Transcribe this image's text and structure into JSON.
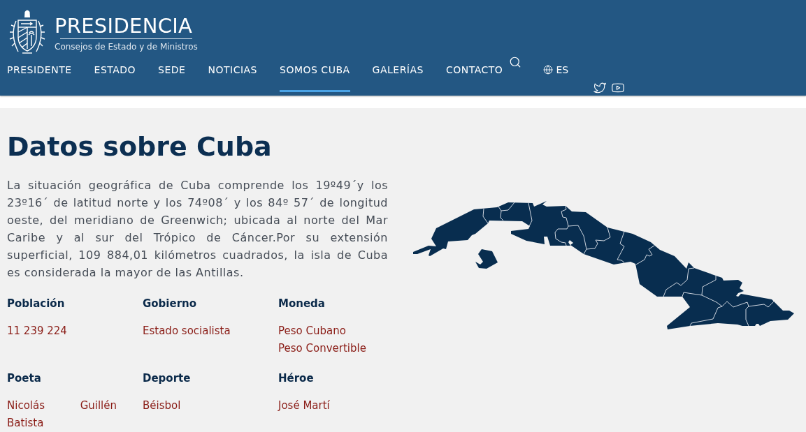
{
  "header": {
    "title": "PRESIDENCIA",
    "subtitle": "Consejos de Estado y de Ministros"
  },
  "nav": {
    "items": [
      {
        "label": "PRESIDENTE",
        "selected": false
      },
      {
        "label": "ESTADO",
        "selected": false
      },
      {
        "label": "SEDE",
        "selected": false
      },
      {
        "label": "NOTICIAS",
        "selected": false
      },
      {
        "label": "SOMOS CUBA",
        "selected": true
      },
      {
        "label": "GALERÍAS",
        "selected": false
      },
      {
        "label": "CONTACTO",
        "selected": false
      }
    ],
    "language": "ES"
  },
  "page": {
    "title": "Datos sobre Cuba",
    "intro": "La situación geográfica de Cuba comprende los 19º49´y los 23º16´ de latitud norte y los 74º08´ y los 84º 57´ de longitud oeste, del meridiano de Greenwich; ubicada al norte del Mar Caribe y al sur del Trópico de Cáncer.Por su extensión superficial, 109 884,01 kilómetros cuadrados, la isla de Cuba es considerada la mayor de las Antillas.",
    "facts": [
      {
        "label": "Población",
        "values": [
          "11 239 224"
        ]
      },
      {
        "label": "Gobierno",
        "values": [
          "Estado socialista"
        ]
      },
      {
        "label": "Moneda",
        "values": [
          "Peso Cubano",
          "Peso Convertible"
        ]
      },
      {
        "label": "Poeta",
        "values": [
          "Nicolás Guillén Batista"
        ]
      },
      {
        "label": "Deporte",
        "values": [
          "Béisbol"
        ]
      },
      {
        "label": "Héroe",
        "values": [
          "José Martí"
        ]
      }
    ]
  }
}
